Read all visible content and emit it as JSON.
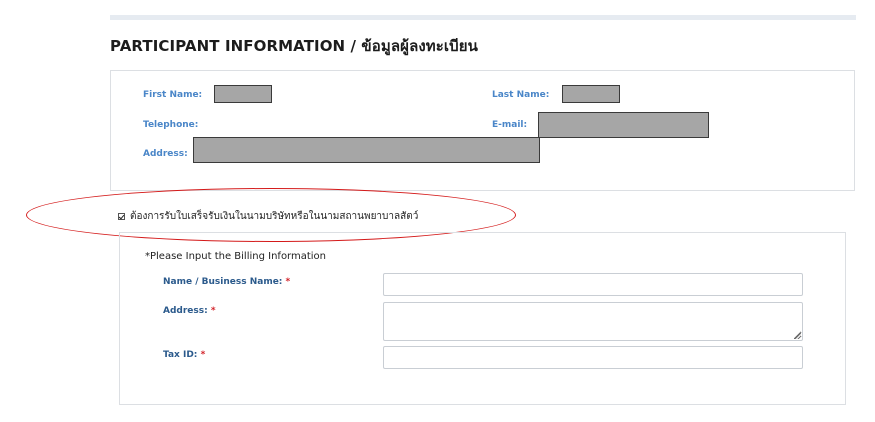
{
  "section": {
    "title": "PARTICIPANT INFORMATION / ข้อมูลผู้ลงทะเบียน"
  },
  "participant": {
    "first_name_label": "First Name:",
    "last_name_label": "Last Name:",
    "telephone_label": "Telephone:",
    "email_label": "E-mail:",
    "address_label": "Address:"
  },
  "billing_toggle": {
    "checked": true,
    "label": "ต้องการรับใบเสร็จรับเงินในนามบริษัทหรือในนามสถานพยาบาลสัตว์"
  },
  "billing": {
    "heading": "*Please Input the Billing Information",
    "name_label": "Name / Business Name:",
    "address_label": "Address:",
    "tax_label": "Tax ID:",
    "required_mark": "*",
    "name_value": "",
    "address_value": "",
    "tax_value": ""
  },
  "colors": {
    "label_blue": "#4a86c8",
    "billing_label_blue": "#2b5a8c",
    "required_red": "#d2232a",
    "highlight_red": "#d41a1a",
    "redaction_gray": "#a6a6a6"
  }
}
